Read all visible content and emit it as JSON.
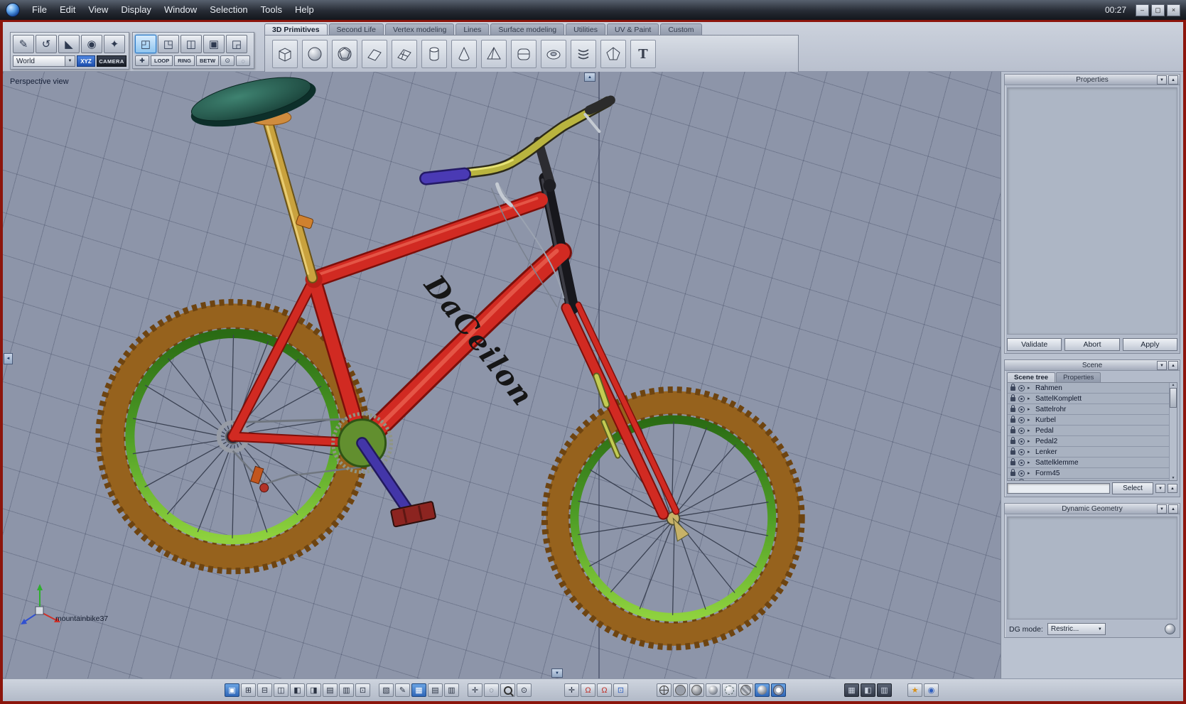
{
  "window": {
    "menu": [
      "File",
      "Edit",
      "View",
      "Display",
      "Window",
      "Selection",
      "Tools",
      "Help"
    ],
    "clock": "00:27"
  },
  "icons": {
    "win_min": "–",
    "win_max": "▢",
    "win_close": "×",
    "tool_pencil": "✎",
    "tool_undo": "↺",
    "tool_wedge": "◣",
    "tool_orb": "◉",
    "tool_lamp": "✦",
    "sel_object": "◰",
    "sel_face": "◳",
    "sel_edge": "◫",
    "sel_vertex": "▣",
    "sel_loop": "◲",
    "sel_mini": "✚",
    "weld": "⊙",
    "mirror": "◌",
    "dropdown_arrow": "▼",
    "spin_up": "▲",
    "spin_down": "▼",
    "expander": "▸",
    "panel_shade": "▼",
    "panel_expand": "▲",
    "text_primitive": "T",
    "layout_1": "▣",
    "layout_2": "⊞",
    "layout_3": "⊟",
    "layout_4": "◫",
    "layout_5": "◧",
    "layout_6": "◨",
    "layout_7": "▤",
    "layout_8": "▥",
    "layout_9": "⊡",
    "uv_unwrap": "▧",
    "annotate_pen": "✎",
    "snap_grid": "▦",
    "table_a": "▤",
    "table_b": "▥",
    "fit_view": "✛",
    "marquee": "◌",
    "eye": "⊙",
    "axis_tool": "✛",
    "magnet_a": "Ω",
    "magnet_b": "Ω",
    "manip_box": "⊡",
    "dark_a": "▦",
    "dark_b": "◧",
    "dark_c": "▥",
    "render_a": "★",
    "render_b": "◉",
    "pan_up": "▲",
    "pan_down": "▼",
    "pan_left": "◄"
  },
  "toolbar": {
    "world": "World",
    "xyz": "XYZ",
    "camera": "CAMERA",
    "loop": "LOOP",
    "ring": "RING",
    "betw": "BETW"
  },
  "tabs": [
    "3D Primitives",
    "Second Life",
    "Vertex modeling",
    "Lines",
    "Surface modeling",
    "Utilities",
    "UV & Paint",
    "Custom"
  ],
  "primitives": [
    "cube",
    "sphere",
    "geodesic sphere",
    "plane",
    "grid",
    "cylinder",
    "cone",
    "pyramid",
    "chamfer cube",
    "torus",
    "helix",
    "platonic solid",
    "text"
  ],
  "viewport": {
    "label": "Perspective view",
    "model_name": "mountainbike37",
    "frame_brand": "DaCeilon"
  },
  "properties_panel": {
    "title": "Properties",
    "validate": "Validate",
    "abort": "Abort",
    "apply": "Apply"
  },
  "scene_panel": {
    "title": "Scene",
    "tab_tree": "Scene tree",
    "tab_props": "Properties",
    "items": [
      "Rahmen",
      "SattelKomplett",
      "Sattelrohr",
      "Kurbel",
      "Pedal",
      "Pedal2",
      "Lenker",
      "Sattelklemme",
      "Form45"
    ],
    "select": "Select"
  },
  "dg_panel": {
    "title": "Dynamic Geometry",
    "mode_label": "DG mode:",
    "mode_value": "Restric..."
  },
  "colors": {
    "accent_blue": "#3f7fd6",
    "frame_red": "#d12a22",
    "rim_green": "#5fae27",
    "tire_brown": "#96621d",
    "window_border_red": "#8c150c"
  }
}
